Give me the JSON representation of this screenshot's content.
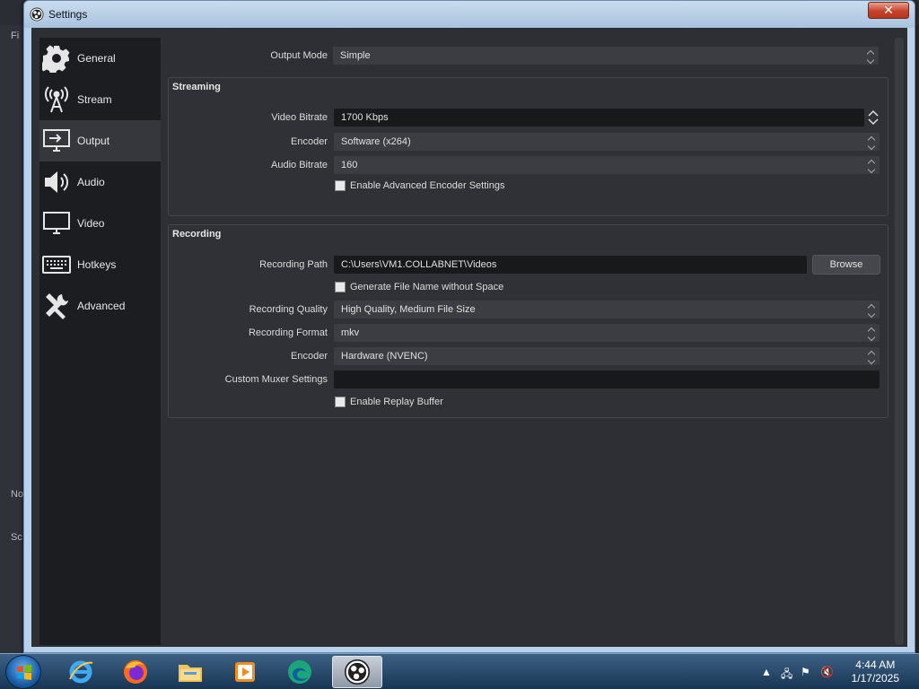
{
  "window": {
    "title": "Settings",
    "close_label": "✕"
  },
  "background_app": {
    "left_labels": [
      "Fi",
      "No",
      "Sc"
    ]
  },
  "sidebar": {
    "items": [
      {
        "label": "General",
        "icon": "gear-icon",
        "active": false
      },
      {
        "label": "Stream",
        "icon": "broadcast-icon",
        "active": false
      },
      {
        "label": "Output",
        "icon": "output-monitor-icon",
        "active": true
      },
      {
        "label": "Audio",
        "icon": "speaker-icon",
        "active": false
      },
      {
        "label": "Video",
        "icon": "monitor-icon",
        "active": false
      },
      {
        "label": "Hotkeys",
        "icon": "keyboard-icon",
        "active": false
      },
      {
        "label": "Advanced",
        "icon": "tools-icon",
        "active": false
      }
    ]
  },
  "output": {
    "output_mode_label": "Output Mode",
    "output_mode_value": "Simple",
    "streaming": {
      "title": "Streaming",
      "video_bitrate_label": "Video Bitrate",
      "video_bitrate_value": "1700 Kbps",
      "encoder_label": "Encoder",
      "encoder_value": "Software (x264)",
      "audio_bitrate_label": "Audio Bitrate",
      "audio_bitrate_value": "160",
      "advanced_encoder_label": "Enable Advanced Encoder Settings"
    },
    "recording": {
      "title": "Recording",
      "path_label": "Recording Path",
      "path_value": "C:\\Users\\VM1.COLLABNET\\Videos",
      "browse_label": "Browse",
      "no_space_label": "Generate File Name without Space",
      "quality_label": "Recording Quality",
      "quality_value": "High Quality, Medium File Size",
      "format_label": "Recording Format",
      "format_value": "mkv",
      "encoder_label": "Encoder",
      "encoder_value": "Hardware (NVENC)",
      "muxer_label": "Custom Muxer Settings",
      "muxer_value": "",
      "replay_buffer_label": "Enable Replay Buffer"
    }
  },
  "taskbar": {
    "apps": [
      "internet-explorer-icon",
      "firefox-icon",
      "file-explorer-icon",
      "media-player-icon",
      "edge-icon",
      "obs-icon"
    ],
    "time": "4:44 AM",
    "date": "1/17/2025"
  }
}
